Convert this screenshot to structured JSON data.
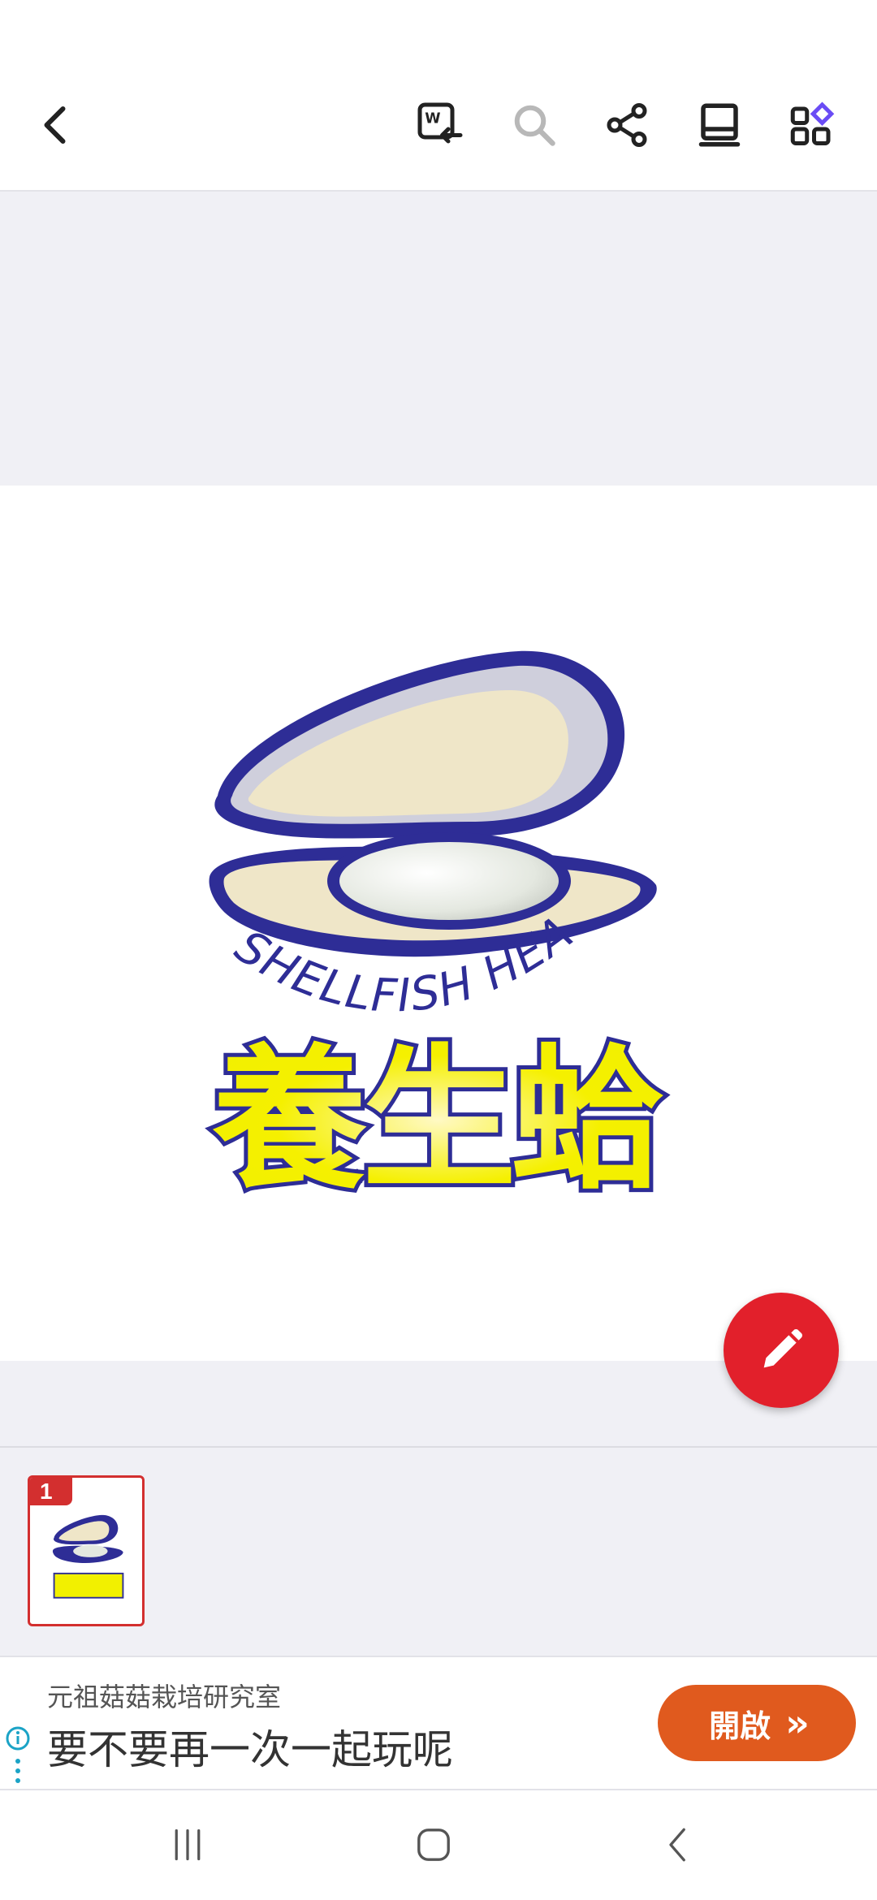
{
  "toolbar": {
    "back_icon": "chevron-left-icon",
    "actions": [
      "convert-to-word-icon",
      "search-icon",
      "share-icon",
      "book-icon",
      "apps-icon"
    ]
  },
  "document": {
    "logo": {
      "english_text": "SHELLFISH HEALTH",
      "chinese_text": "養生蛤"
    }
  },
  "fab": {
    "icon": "pencil-icon",
    "color": "#e2202b"
  },
  "thumbnails": [
    {
      "page_number": "1"
    }
  ],
  "ad": {
    "subtitle": "元祖菇菇栽培研究室",
    "title": "要不要再一次一起玩呢",
    "button_label": "開啟",
    "button_arrows": "»",
    "button_color": "#e05a1e"
  },
  "navbar": {
    "buttons": [
      "recent-apps-icon",
      "home-icon",
      "back-icon"
    ]
  },
  "colors": {
    "accent_red": "#d32f2f",
    "logo_blue": "#2e2d96",
    "logo_yellow": "#f2f000"
  }
}
